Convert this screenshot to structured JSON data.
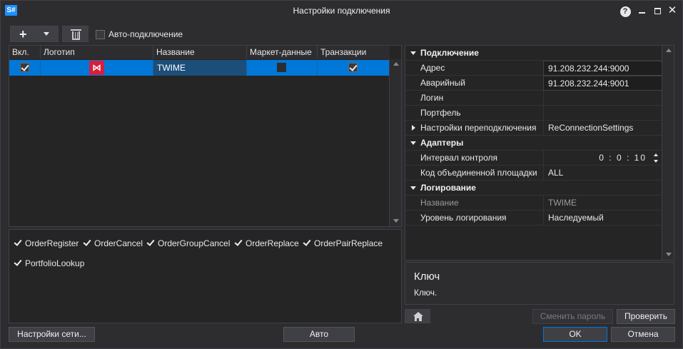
{
  "window": {
    "app_icon": "S#",
    "title": "Настройки подключения",
    "help_glyph": "?",
    "close_glyph": "✕"
  },
  "toolbar": {
    "add_glyph": "+",
    "autoconnect_label": "Авто-подключение",
    "autoconnect_checked": false
  },
  "grid": {
    "columns": [
      "Вкл.",
      "Логотип",
      "Название",
      "Маркет-данные",
      "Транзакции"
    ],
    "rows": [
      {
        "enabled": true,
        "logo_glyph": "⋈",
        "name": "TWIME",
        "market_data": false,
        "transactions": true
      }
    ]
  },
  "messages": [
    {
      "label": "OrderRegister",
      "checked": true
    },
    {
      "label": "OrderCancel",
      "checked": true
    },
    {
      "label": "OrderGroupCancel",
      "checked": true
    },
    {
      "label": "OrderReplace",
      "checked": true
    },
    {
      "label": "OrderPairReplace",
      "checked": true
    },
    {
      "label": "PortfolioLookup",
      "checked": true
    }
  ],
  "properties": {
    "connection": {
      "title": "Подключение",
      "address_key": "Адрес",
      "address_value": "91.208.232.244:9000",
      "backup_key": "Аварийный",
      "backup_value": "91.208.232.244:9001",
      "login_key": "Логин",
      "login_value": "",
      "portfolio_key": "Портфель",
      "portfolio_value": "",
      "reconnect_key": "Настройки переподключения",
      "reconnect_value": "ReConnectionSettings"
    },
    "adapters": {
      "title": "Адаптеры",
      "interval_key": "Интервал контроля",
      "interval_value": "0 : 0 : 10",
      "board_key": "Код объединенной площадки",
      "board_value": "ALL"
    },
    "logging": {
      "title": "Логирование",
      "name_key": "Название",
      "name_value": "TWIME",
      "level_key": "Уровень логирования",
      "level_value": "Наследуемый"
    }
  },
  "description": {
    "heading": "Ключ",
    "text": "Ключ."
  },
  "buttons": {
    "change_password": "Сменить пароль",
    "check": "Проверить",
    "network_settings": "Настройки сети...",
    "auto": "Авто",
    "ok": "OK",
    "cancel": "Отмена"
  },
  "colors": {
    "background": "#2d2d30",
    "selection": "#0078d7",
    "logo": "#d61f3b"
  }
}
